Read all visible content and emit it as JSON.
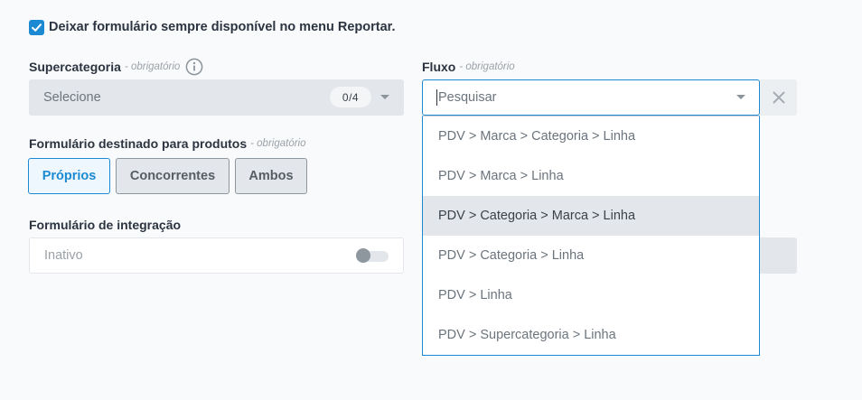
{
  "always_available": {
    "label": "Deixar formulário sempre disponível no menu Reportar.",
    "checked": true
  },
  "required_text": "- obrigatório",
  "supercategoria": {
    "label": "Supercategoria",
    "placeholder": "Selecione",
    "counter": "0/4"
  },
  "destinado": {
    "label": "Formulário destinado para produtos",
    "options": [
      "Próprios",
      "Concorrentes",
      "Ambos"
    ],
    "selected": "Próprios"
  },
  "integracao": {
    "label": "Formulário de integração",
    "status": "Inativo",
    "enabled": false
  },
  "fluxo": {
    "label": "Fluxo",
    "search_placeholder": "Pesquisar",
    "options": [
      "PDV > Marca > Categoria > Linha",
      "PDV > Marca > Linha",
      "PDV > Categoria > Marca > Linha",
      "PDV > Categoria > Linha",
      "PDV > Linha",
      "PDV > Supercategoria > Linha"
    ],
    "highlighted": "PDV > Categoria > Marca > Linha"
  },
  "colors": {
    "accent": "#1c8ad2",
    "disabled_bg": "#e3e6ea",
    "page_bg": "#f9fafb"
  }
}
